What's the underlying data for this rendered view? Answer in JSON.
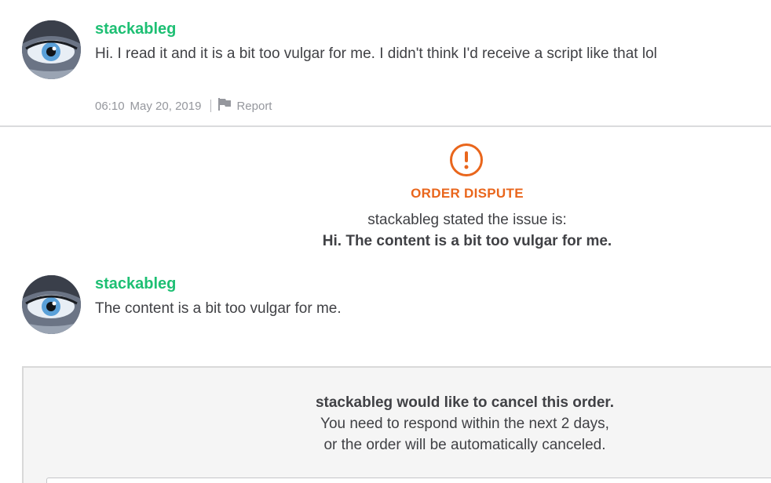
{
  "messages": [
    {
      "username": "stackableg",
      "text": "Hi. I read it and it is a bit too vulgar for me. I didn't think I'd receive a script like that lol",
      "time": "06:10",
      "date": "May 20, 2019",
      "report_label": "Report"
    },
    {
      "username": "stackableg",
      "text": "The content is a bit too vulgar for me."
    }
  ],
  "dispute": {
    "title": "ORDER DISPUTE",
    "stated": "stackableg stated the issue is:",
    "issue": "Hi. The content is a bit too vulgar for me."
  },
  "cancel_request": {
    "title": "stackableg would like to cancel this order.",
    "line1": "You need to respond within the next 2 days,",
    "line2": "or the order will be automatically canceled."
  },
  "colors": {
    "username": "#1dbf73",
    "dispute_accent": "#e9661c",
    "text": "#404145",
    "muted": "#95979d"
  },
  "icons": {
    "avatar": "eye-avatar",
    "report": "flag-icon",
    "dispute": "exclamation-circle-icon"
  }
}
